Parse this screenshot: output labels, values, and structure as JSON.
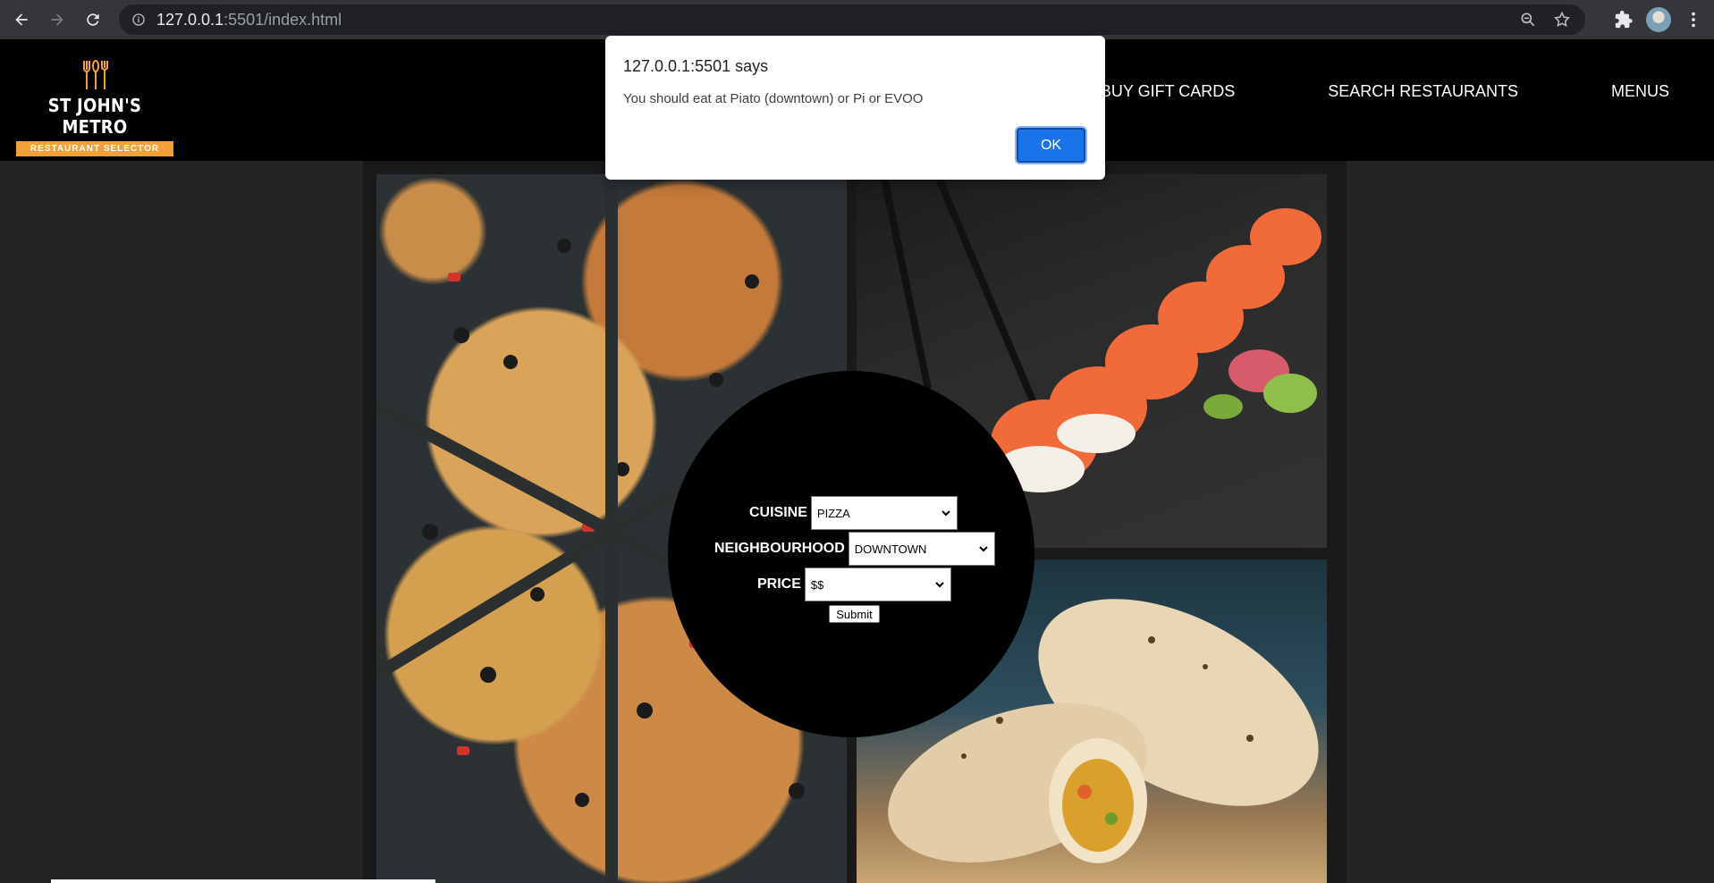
{
  "browser": {
    "url_host": "127.0.0.1",
    "url_rest": ":5501/index.html",
    "icons": [
      "back-arrow-icon",
      "forward-arrow-icon",
      "reload-icon",
      "info-icon",
      "zoom-icon",
      "star-icon",
      "extensions-icon",
      "avatar",
      "menu-dots-icon"
    ]
  },
  "header": {
    "logo_title": "ST JOHN'S METRO",
    "logo_subtitle": "RESTAURANT SELECTOR",
    "nav": [
      "BUY GIFT CARDS",
      "SEARCH RESTAURANTS",
      "MENUS"
    ]
  },
  "form": {
    "cuisine_label": "CUISINE",
    "cuisine_value": "PIZZA",
    "neighbourhood_label": "NEIGHBOURHOOD",
    "neighbourhood_value": "DOWNTOWN",
    "price_label": "PRICE",
    "price_value": "$$",
    "submit_label": "Submit"
  },
  "dialog": {
    "title": "127.0.0.1:5501 says",
    "message": "You should eat at Piato (downtown) or Pi or EVOO",
    "ok_label": "OK"
  },
  "colors": {
    "accent": "#f2a13a",
    "dialog_button": "#1a73e8",
    "chrome_bg": "#35363a"
  }
}
